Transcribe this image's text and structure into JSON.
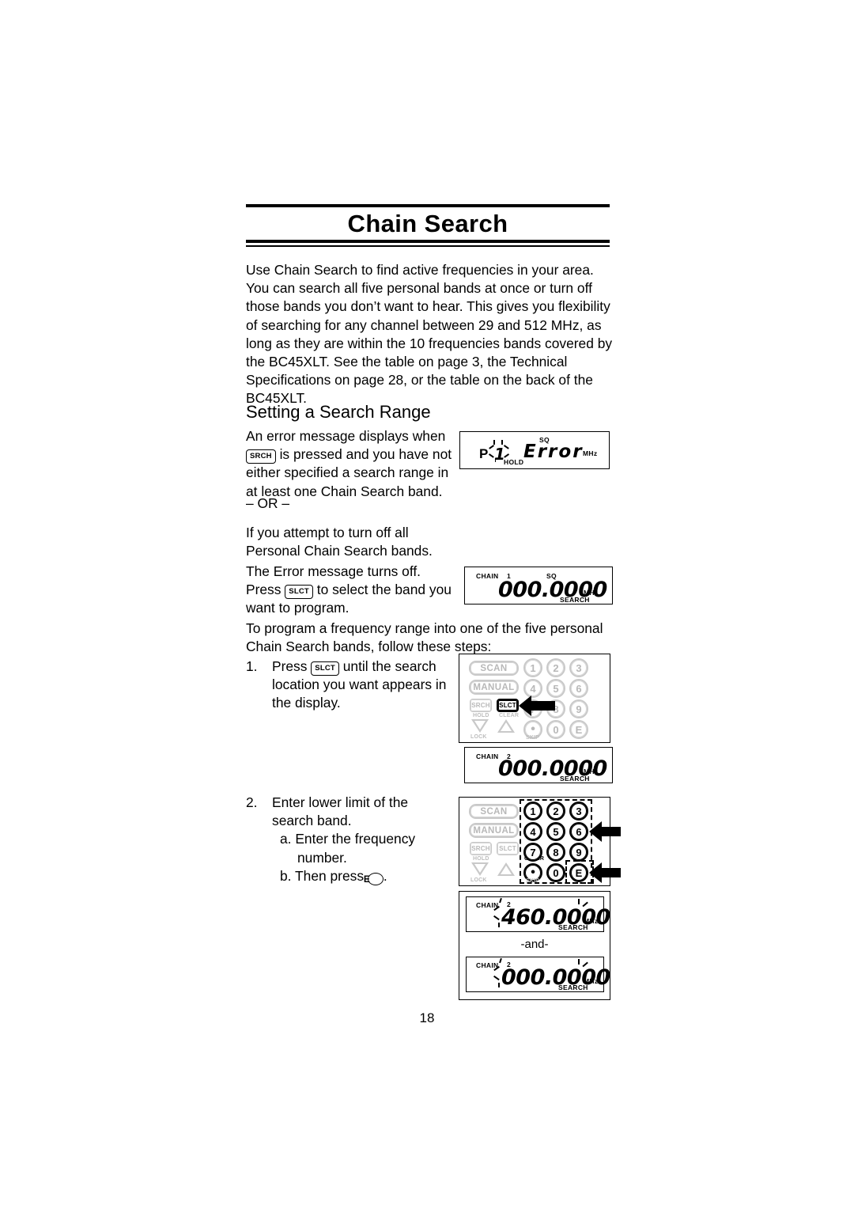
{
  "document": {
    "title": "Chain Search",
    "page_number": "18",
    "intro_paragraph": "Use Chain Search to find active frequencies in your area. You can search all five personal bands at once or turn off those bands you don’t want to hear. This gives you flexibility of searching for any channel between 29 and 512 MHz, as long as they are within the 10 frequencies bands covered by the BC45XLT. See the table on page 3, the Technical Specifications on page 28, or the table on the back of the BC45XLT.",
    "section_heading": "Setting a Search Range",
    "error_text_part1": "An error message displays when",
    "error_key": "SRCH",
    "error_text_part2": "is pressed and you have not either specified a search range in at least one Chain Search band.",
    "or_divider": "– OR –",
    "turnoff_text": "If you attempt to turn off all Personal Chain Search bands.",
    "errors_off_line1": "The Error message turns off.",
    "errors_off_press": "Press",
    "errors_off_key": "SLCT",
    "errors_off_line2": "to select the band you want to program.",
    "program_text": "To program a frequency range into one of the five personal Chain Search bands, follow these steps:",
    "step1": {
      "number": "1.",
      "press_word": "Press",
      "key": "SLCT",
      "rest": "until the search location you want appears in the display."
    },
    "step2": {
      "number": "2.",
      "text": "Enter lower limit of the search band.",
      "sub_a": "a. Enter the frequency number.",
      "sub_b_pre": "b. Then press",
      "sub_b_key": "E",
      "sub_b_post": "."
    },
    "and_label": "-and-"
  },
  "lcd_displays": [
    {
      "id": "error-display",
      "prefix": "P",
      "blink_digit": "1",
      "hold_label": "HOLD",
      "sq_label": "SQ",
      "message": "Error",
      "unit": "MHz"
    },
    {
      "id": "chain1-display",
      "chain_label": "CHAIN",
      "chain_number": "1",
      "sq_label": "SQ",
      "frequency": "000.0000",
      "unit": "MHz",
      "mode_label": "SEARCH"
    },
    {
      "id": "chain2-display",
      "chain_label": "CHAIN",
      "chain_number": "2",
      "frequency": "000.0000",
      "unit": "MHz",
      "mode_label": "SEARCH"
    },
    {
      "id": "chain2-460-display",
      "chain_label": "CHAIN",
      "chain_number": "2",
      "frequency": "460.0000",
      "unit": "MHz",
      "mode_label": "SEARCH"
    },
    {
      "id": "chain2-000-display",
      "chain_label": "CHAIN",
      "chain_number": "2",
      "frequency": "000.0000",
      "unit": "MHz",
      "mode_label": "SEARCH"
    }
  ],
  "keypad": {
    "scan": "SCAN",
    "manual": "MANUAL",
    "srch": "SRCH",
    "slct": "SLCT",
    "hold": "HOLD",
    "clear": "CLEAR",
    "lock": "LOCK",
    "skip": "SKIP",
    "k1": "1",
    "k2": "2",
    "k3": "3",
    "k4": "4",
    "k5": "5",
    "k6": "6",
    "k7": "7",
    "k8": "8",
    "k9": "9",
    "k0": "0",
    "kdot": "•",
    "ke": "E"
  },
  "colors": {
    "ink": "#000000",
    "dimmed_key": "#c9c9c9",
    "paper": "#ffffff"
  }
}
